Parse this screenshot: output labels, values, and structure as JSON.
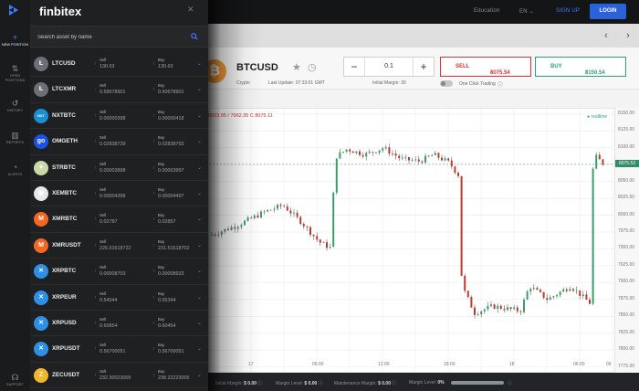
{
  "brand": {
    "name": "finbitex"
  },
  "topbar": {
    "links": [
      "Education",
      "EN"
    ],
    "signup": "SIGN UP",
    "login": "LOGIN"
  },
  "rail": [
    {
      "label": "NEW POSITION",
      "icon": "plus-icon",
      "active": true
    },
    {
      "label": "OPEN POSITIONS",
      "icon": "swap-icon"
    },
    {
      "label": "HISTORY",
      "icon": "history-icon"
    },
    {
      "label": "REPORTS",
      "icon": "bar-chart-icon"
    },
    {
      "label": "ALERTS",
      "icon": "stopwatch-icon"
    },
    {
      "label": "SUPPORT",
      "icon": "headset-icon"
    }
  ],
  "search": {
    "placeholder": "Search asset by name"
  },
  "assets": [
    {
      "symbol": "LTCUSD",
      "coin": "ltc",
      "color": "#6b6f76",
      "glyph": "Ł",
      "sell_label": "Sell",
      "sell": "130.63",
      "sell_dir": "up",
      "buy_label": "Buy",
      "buy": "130.63",
      "buy_dir": "up"
    },
    {
      "symbol": "LTCXMR",
      "coin": "ltc",
      "color": "#6b6f76",
      "glyph": "Ł",
      "sell_label": "Sell",
      "sell": "0.58678901",
      "sell_dir": "down",
      "buy_label": "Buy",
      "buy": "0.60678901",
      "buy_dir": "up"
    },
    {
      "symbol": "NXTBTC",
      "coin": "nxt",
      "color": "#1a8fd4",
      "glyph": "NXT",
      "sell_label": "Sell",
      "sell": "0.00000398",
      "sell_dir": "up",
      "buy_label": "Buy",
      "buy": "0.00000418",
      "buy_dir": "up"
    },
    {
      "symbol": "OMGETH",
      "coin": "omg",
      "color": "#1a52e8",
      "glyph": "go",
      "sell_label": "Sell",
      "sell": "0.02838739",
      "sell_dir": "up",
      "buy_label": "Buy",
      "buy": "0.02838793",
      "buy_dir": "up"
    },
    {
      "symbol": "STRBTC",
      "coin": "str",
      "color": "#c9d9a7",
      "glyph": "✦",
      "sell_label": "Sell",
      "sell": "0.00003898",
      "sell_dir": "up",
      "buy_label": "Buy",
      "buy": "0.00003997",
      "buy_dir": "up"
    },
    {
      "symbol": "XEMBTC",
      "coin": "xem",
      "color": "#e8e8e8",
      "glyph": "◉",
      "sell_label": "Sell",
      "sell": "0.00004398",
      "sell_dir": "up",
      "buy_label": "Buy",
      "buy": "0.00004497",
      "buy_dir": "up"
    },
    {
      "symbol": "XMRBTC",
      "coin": "xmr",
      "color": "#f26822",
      "glyph": "M",
      "sell_label": "Sell",
      "sell": "0.02787",
      "sell_dir": "up",
      "buy_label": "Buy",
      "buy": "0.02857",
      "buy_dir": "up"
    },
    {
      "symbol": "XMRUSDT",
      "coin": "xmr",
      "color": "#f26822",
      "glyph": "M",
      "sell_label": "Sell",
      "sell": "226.01618722",
      "sell_dir": "up",
      "buy_label": "Buy",
      "buy": "231.51618702",
      "buy_dir": "up"
    },
    {
      "symbol": "XRPBTC",
      "coin": "xrp",
      "color": "#2d8fe6",
      "glyph": "✕",
      "sell_label": "Sell",
      "sell": "0.00008703",
      "sell_dir": "up",
      "buy_label": "Buy",
      "buy": "0.00008933",
      "buy_dir": "up"
    },
    {
      "symbol": "XRPEUR",
      "coin": "xrp",
      "color": "#2d8fe6",
      "glyph": "✕",
      "sell_label": "Sell",
      "sell": "0.54044",
      "sell_dir": "up",
      "buy_label": "Buy",
      "buy": "0.55344",
      "buy_dir": "up"
    },
    {
      "symbol": "XRPUSD",
      "coin": "xrp",
      "color": "#2d8fe6",
      "glyph": "✕",
      "sell_label": "Sell",
      "sell": "0.60854",
      "sell_dir": "up",
      "buy_label": "Buy",
      "buy": "0.60454",
      "buy_dir": "up"
    },
    {
      "symbol": "XRPUSDT",
      "coin": "xrp",
      "color": "#2d8fe6",
      "glyph": "✕",
      "sell_label": "Sell",
      "sell": "0.56700051",
      "sell_dir": "up",
      "buy_label": "Buy",
      "buy": "0.56700051",
      "buy_dir": "up"
    },
    {
      "symbol": "ZECUSDT",
      "coin": "zec",
      "color": "#f4b728",
      "glyph": "Z",
      "sell_label": "Sell",
      "sell": "232.30023005",
      "sell_dir": "up",
      "buy_label": "Buy",
      "buy": "238.22223005",
      "buy_dir": "up"
    }
  ],
  "trade": {
    "pair": "BTCUSD",
    "category": "Crypto",
    "last_update": "Last Update: 07:33:01 GMT",
    "qty": "0.1",
    "initial_margin": "Initial Margin: 30",
    "sell_label": "SELL",
    "sell_price": "8075.54",
    "buy_label": "BUY",
    "buy_price": "8150.54",
    "one_click": "One Click Trading"
  },
  "chart_data": {
    "type": "candlestick",
    "ohlc_line": "8023.95 / 7962.35 C 8075.11",
    "realtime_label": "realtime",
    "current_price": "8075.53",
    "y_ticks": [
      "8150.00",
      "8125.00",
      "8100.00",
      "8075.00",
      "8050.00",
      "8025.00",
      "8000.00",
      "7975.00",
      "7950.00",
      "7925.00",
      "7900.00",
      "7875.00",
      "7850.00",
      "7825.00",
      "7800.00",
      "7775.00"
    ],
    "x_ticks": [
      "17",
      "06:00",
      "12:00",
      "18:00",
      "18",
      "06:00",
      "09"
    ],
    "ylim": [
      7765,
      8158
    ],
    "grid": true
  },
  "status": {
    "initial_margin_label": "Initial Margin:",
    "initial_margin": "$ 0.00",
    "margin_level_label": "Margin Level:",
    "margin_level": "$ 0.00",
    "maintenance_label": "Maintenance Margin:",
    "maintenance": "$ 0.00",
    "margin_pct_label": "Margin Level:",
    "margin_pct": "0%"
  }
}
